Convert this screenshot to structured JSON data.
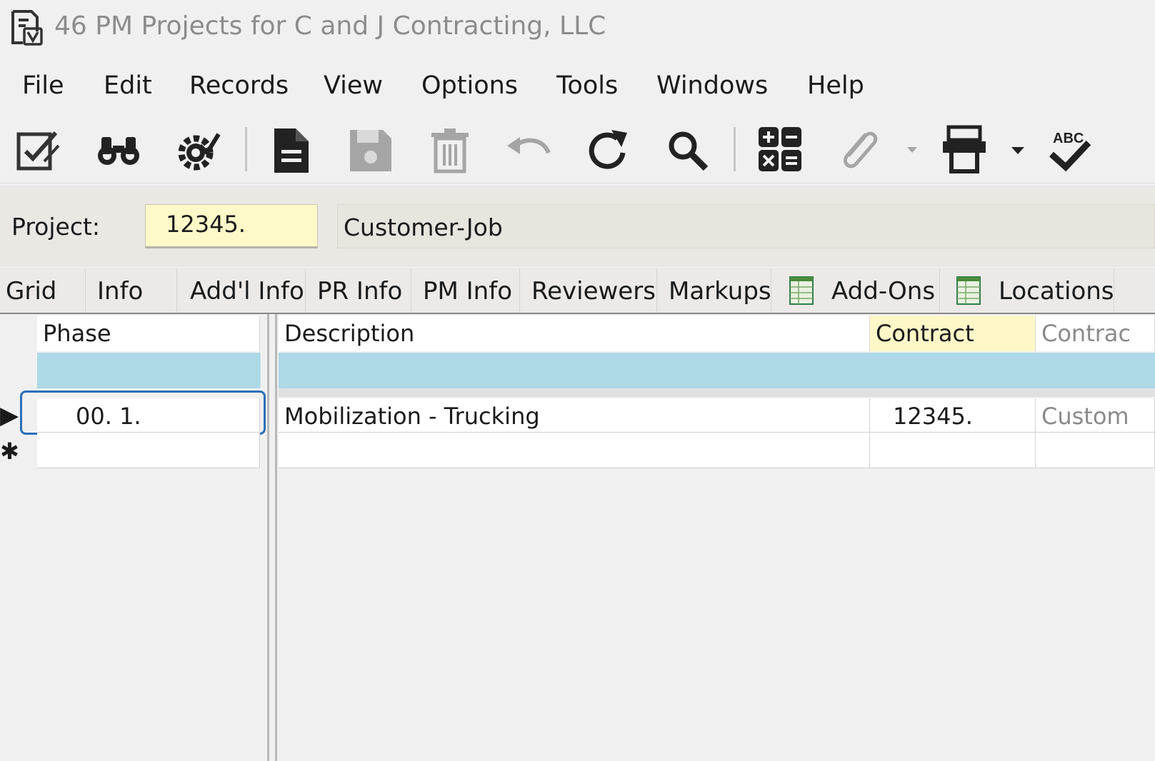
{
  "window": {
    "title": "46 PM Projects for C and J Contracting, LLC",
    "app_icon": "viewpoint-app-icon"
  },
  "menu": [
    "File",
    "Edit",
    "Records",
    "View",
    "Options",
    "Tools",
    "Windows",
    "Help"
  ],
  "toolbar": {
    "icons": [
      "edit-form-icon",
      "binoculars-icon",
      "settings-gear-icon",
      "new-record-icon",
      "save-icon",
      "delete-icon",
      "undo-icon",
      "refresh-icon",
      "search-icon",
      "calculator-icon",
      "attachment-icon",
      "print-icon",
      "spell-check-icon"
    ],
    "spell_check_label": "ABC"
  },
  "header": {
    "project_label": "Project:",
    "project_value": "12345.",
    "project_description": "Customer-Job"
  },
  "tabs": [
    "Grid",
    "Info",
    "Add'l Info",
    "PR Info",
    "PM Info",
    "Reviewers",
    "Markups",
    "Add-Ons",
    "Locations"
  ],
  "grid": {
    "columns": [
      "Phase",
      "Description",
      "Contract",
      "Contrac"
    ],
    "rows": [
      {
        "phase": "00.  1.",
        "description": "Mobilization - Trucking",
        "contract": "12345.",
        "contract_desc": "Custom"
      }
    ],
    "current_row_marker": "▶",
    "new_row_marker": "✱"
  },
  "colors": {
    "filter_row": "#add8e6",
    "project_field": "#fff9c9",
    "contract_header": "#fff7c8",
    "focus_border": "#2a6fb8"
  }
}
